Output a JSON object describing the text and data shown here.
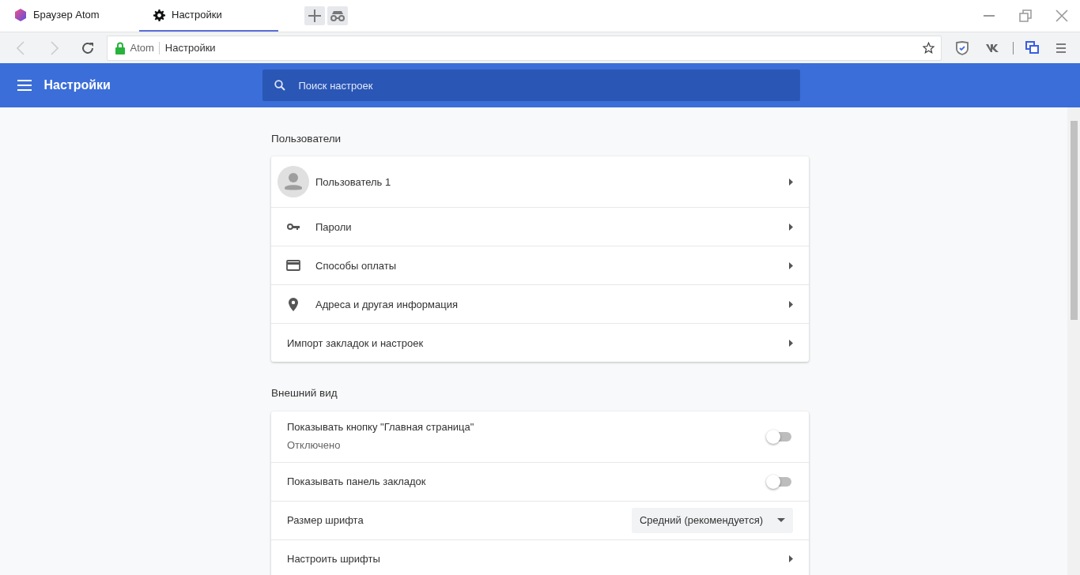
{
  "tabs": [
    {
      "kind": "logo",
      "title": "Браузер Atom",
      "selected": false
    },
    {
      "kind": "gear",
      "title": "Настройки",
      "selected": true
    }
  ],
  "address": {
    "site": "Atom",
    "page": "Настройки"
  },
  "header": {
    "title": "Настройки",
    "search_placeholder": "Поиск настроек"
  },
  "sections": [
    {
      "title": "Пользователи",
      "rows": [
        {
          "kind": "avatar",
          "label": "Пользователь 1"
        },
        {
          "kind": "key",
          "label": "Пароли"
        },
        {
          "kind": "card",
          "label": "Способы оплаты"
        },
        {
          "kind": "pin",
          "label": "Адреса и другая информация"
        },
        {
          "kind": "plain",
          "label": "Импорт закладок и настроек"
        }
      ]
    },
    {
      "title": "Внешний вид",
      "rows": [
        {
          "kind": "toggle",
          "label": "Показывать кнопку \"Главная страница\"",
          "sublabel": "Отключено",
          "on": false
        },
        {
          "kind": "toggle",
          "label": "Показывать панель закладок",
          "on": false
        },
        {
          "kind": "select",
          "label": "Размер шрифта",
          "value": "Средний (рекомендуется)"
        },
        {
          "kind": "plain",
          "label": "Настроить шрифты"
        }
      ]
    }
  ]
}
